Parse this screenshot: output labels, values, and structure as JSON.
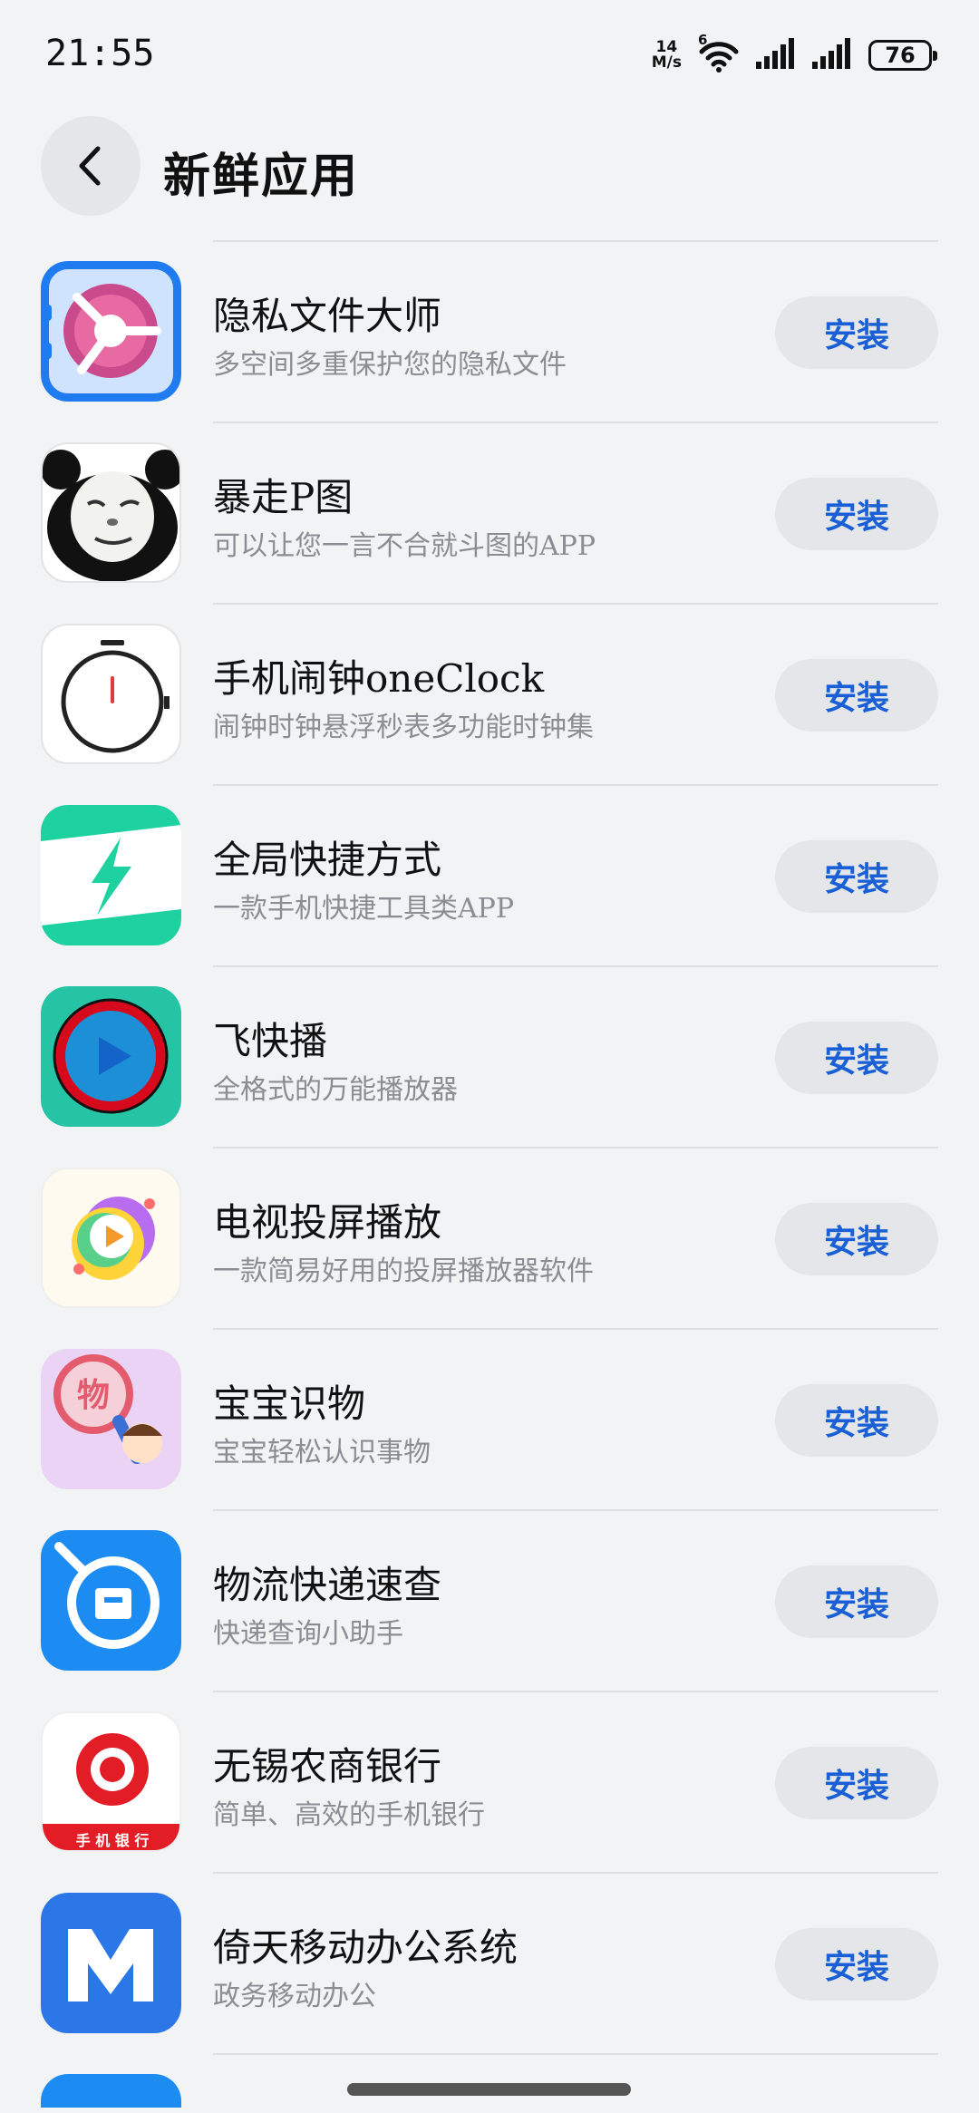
{
  "status_bar": {
    "time": "21:55",
    "net_speed_value": "14",
    "net_speed_unit": "M/s",
    "network_type": "6",
    "battery": "76"
  },
  "header": {
    "title": "新鲜应用"
  },
  "install_label": "安装",
  "apps": [
    {
      "name": "隐私文件大师",
      "desc": "多空间多重保护您的隐私文件",
      "icon": "safe-dial-icon"
    },
    {
      "name": "暴走P图",
      "desc": "可以让您一言不合就斗图的APP",
      "icon": "panda-meme-icon"
    },
    {
      "name": "手机闹钟oneClock",
      "desc": "闹钟时钟悬浮秒表多功能时钟集",
      "icon": "stopwatch-icon"
    },
    {
      "name": "全局快捷方式",
      "desc": "一款手机快捷工具类APP",
      "icon": "lightning-icon"
    },
    {
      "name": "飞快播",
      "desc": "全格式的万能播放器",
      "icon": "play-ring-icon"
    },
    {
      "name": "电视投屏播放",
      "desc": "一款简易好用的投屏播放器软件",
      "icon": "screencast-play-icon"
    },
    {
      "name": "宝宝识物",
      "desc": "宝宝轻松认识事物",
      "icon": "magnifier-child-icon",
      "icon_text": "物"
    },
    {
      "name": "物流快递速查",
      "desc": "快递查询小助手",
      "icon": "parcel-search-icon"
    },
    {
      "name": "无锡农商银行",
      "desc": "简单、高效的手机银行",
      "icon": "bank-logo-icon",
      "icon_text": "手 机 银 行"
    },
    {
      "name": "倚天移动办公系统",
      "desc": "政务移动办公",
      "icon": "m-logo-icon"
    }
  ]
}
